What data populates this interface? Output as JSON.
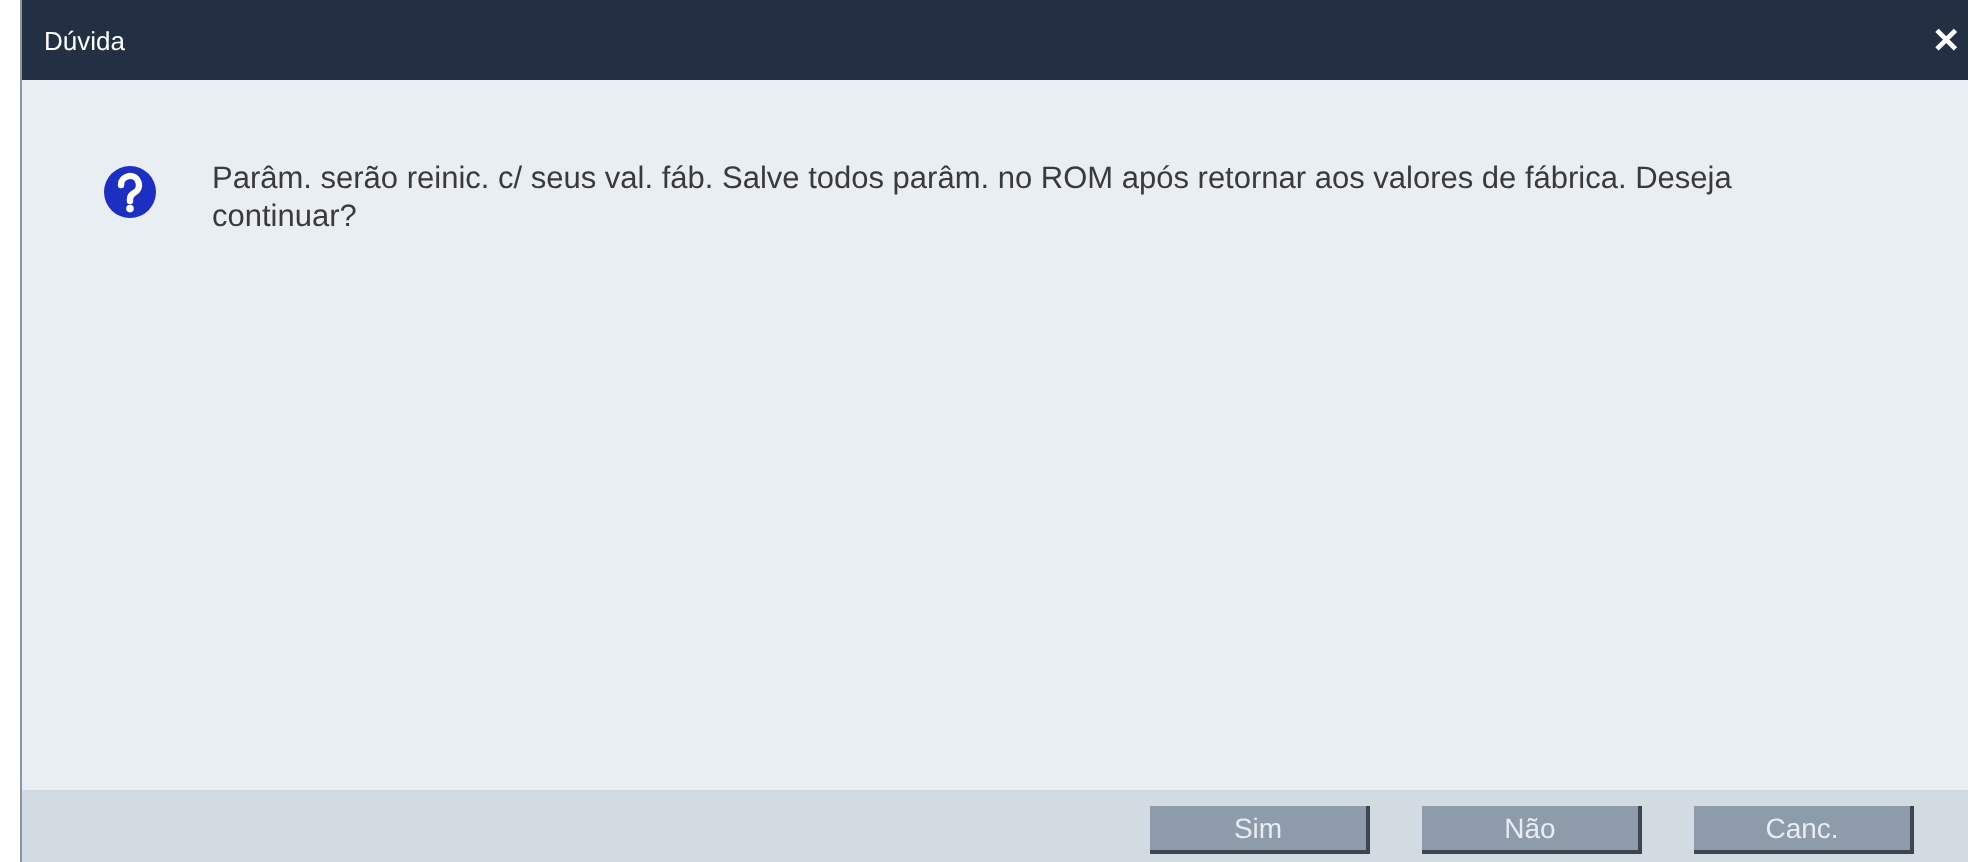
{
  "window": {
    "title": "Dúvida",
    "close": "✕"
  },
  "message": "Parâm. serão reinic. c/ seus val. fáb. Salve todos parâm. no ROM após retornar aos valores de fábrica. Deseja continuar?",
  "buttons": [
    "Sim",
    "Não",
    "Canc."
  ]
}
